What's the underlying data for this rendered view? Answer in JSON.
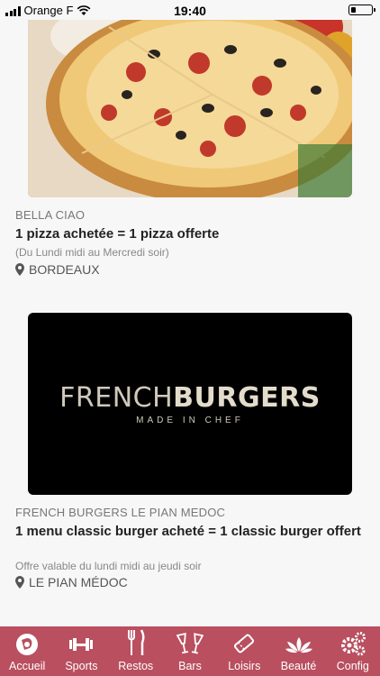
{
  "status": {
    "carrier": "Orange F",
    "time": "19:40"
  },
  "cards": [
    {
      "restaurant": "BELLA CIAO",
      "offer": "1 pizza achetée = 1 pizza offerte",
      "detail": "(Du Lundi midi au Mercredi soir)",
      "city": "BORDEAUX"
    },
    {
      "restaurant": "FRENCH BURGERS LE PIAN MEDOC",
      "offer": "1 menu classic burger acheté = 1 classic burger offert",
      "detail": "Offre valable du lundi midi au jeudi soir",
      "city": "LE PIAN MÉDOC"
    }
  ],
  "logo": {
    "word_thin": "FRENCH",
    "word_bold": "BURGERS",
    "tagline": "MADE IN CHEF"
  },
  "tabs": [
    {
      "label": "Accueil",
      "icon": "home-logo-icon"
    },
    {
      "label": "Sports",
      "icon": "dumbbell-icon"
    },
    {
      "label": "Restos",
      "icon": "fork-knife-icon"
    },
    {
      "label": "Bars",
      "icon": "cocktail-glasses-icon"
    },
    {
      "label": "Loisirs",
      "icon": "ticket-icon"
    },
    {
      "label": "Beauté",
      "icon": "lotus-icon"
    },
    {
      "label": "Config",
      "icon": "gears-icon"
    }
  ],
  "colors": {
    "tabbar": "#b94f5f",
    "background": "#f7f7f7"
  }
}
